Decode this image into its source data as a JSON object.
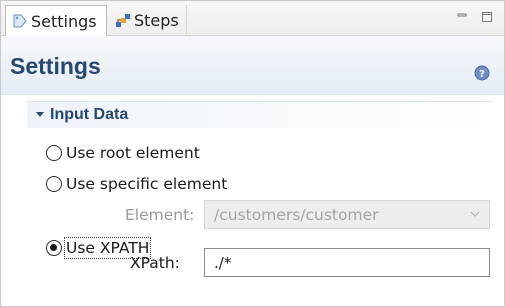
{
  "tabs": [
    {
      "label": "Settings",
      "icon": "tag-icon",
      "active": true
    },
    {
      "label": "Steps",
      "icon": "steps-icon",
      "active": false
    }
  ],
  "header": {
    "title": "Settings",
    "help_icon": "help-icon"
  },
  "section": {
    "title": "Input Data",
    "expanded": true
  },
  "radios": [
    {
      "label": "Use root element",
      "checked": false
    },
    {
      "label": "Use specific element",
      "checked": false
    },
    {
      "label": "Use XPATH",
      "checked": true
    }
  ],
  "element_field": {
    "label": "Element:",
    "value": "/customers/customer",
    "enabled": false
  },
  "xpath_field": {
    "label": "XPath:",
    "value": "./*"
  },
  "colors": {
    "title": "#26476f",
    "section_bg": "#eef3f9",
    "disabled_text": "#9a9a9a"
  }
}
